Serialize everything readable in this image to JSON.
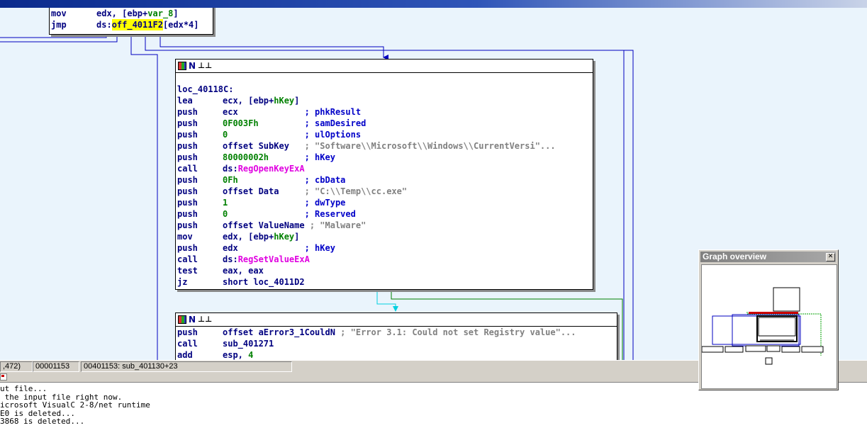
{
  "top_block": {
    "lines": [
      {
        "mnemonic": "mov",
        "operand_before": "edx, [ebp+",
        "operand_name": "var_8",
        "operand_after": "]"
      },
      {
        "mnemonic": "jmp",
        "operand_before": "ds:",
        "operand_highlight": "off_4011F2",
        "operand_after": "[edx*4]"
      }
    ]
  },
  "node1": {
    "label": "loc_40118C:",
    "lines": [
      {
        "mnemonic": "lea",
        "op1": "ecx, [ebp+",
        "op_name": "hKey",
        "op2": "]",
        "comment": ""
      },
      {
        "mnemonic": "push",
        "op1": "ecx             ",
        "comment": "; phkResult"
      },
      {
        "mnemonic": "push",
        "num": "0F003Fh",
        "pad": "         ",
        "comment": "; samDesired"
      },
      {
        "mnemonic": "push",
        "num": "0",
        "pad": "               ",
        "comment": "; ulOptions"
      },
      {
        "mnemonic": "push",
        "op1": "offset SubKey   ",
        "string": "; \"Software\\\\Microsoft\\\\Windows\\\\CurrentVersi\"..."
      },
      {
        "mnemonic": "push",
        "num": "80000002h",
        "pad": "       ",
        "comment": "; hKey"
      },
      {
        "mnemonic": "call",
        "op1": "ds:",
        "api": "RegOpenKeyExA"
      },
      {
        "mnemonic": "push",
        "num": "0Fh",
        "pad": "             ",
        "comment": "; cbData"
      },
      {
        "mnemonic": "push",
        "op1": "offset Data     ",
        "string": "; \"C:\\\\Temp\\\\cc.exe\""
      },
      {
        "mnemonic": "push",
        "num": "1",
        "pad": "               ",
        "comment": "; dwType"
      },
      {
        "mnemonic": "push",
        "num": "0",
        "pad": "               ",
        "comment": "; Reserved"
      },
      {
        "mnemonic": "push",
        "op1": "offset ValueName ",
        "string": "; \"Malware\""
      },
      {
        "mnemonic": "mov",
        "op1": "edx, [ebp+",
        "op_name": "hKey",
        "op2": "]"
      },
      {
        "mnemonic": "push",
        "op1": "edx             ",
        "comment": "; hKey"
      },
      {
        "mnemonic": "call",
        "op1": "ds:",
        "api": "RegSetValueExA"
      },
      {
        "mnemonic": "test",
        "op1": "eax, eax"
      },
      {
        "mnemonic": "jz",
        "op1": "short loc_4011D2"
      }
    ]
  },
  "node2": {
    "lines": [
      {
        "mnemonic": "push",
        "op1": "offset aError3_1CouldN ",
        "string": "; \"Error 3.1: Could not set Registry value\"..."
      },
      {
        "mnemonic": "call",
        "op1": "sub_401271"
      },
      {
        "mnemonic": "add",
        "op1": "esp, ",
        "num": "4"
      }
    ]
  },
  "status": {
    "coords": ",472)",
    "offset": "00001153",
    "location": "00401153: sub_401130+23"
  },
  "output_lines": [
    "ut file...",
    " the input file right now.",
    "icrosoft VisualC 2-8/net runtime",
    "E0 is deleted...",
    "3868 is deleted..."
  ],
  "graph_overview": {
    "title": "Graph overview",
    "close_glyph": "✕"
  },
  "colors": {
    "edge_blue": "#0000c0",
    "edge_cyan": "#00e0e0",
    "edge_green": "#008000",
    "graph_bg": "#eaf4fc"
  }
}
